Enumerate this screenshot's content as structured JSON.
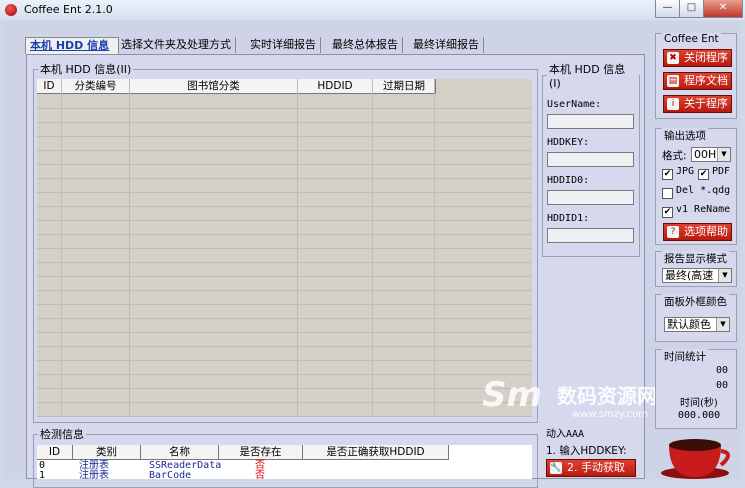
{
  "window": {
    "title": "Coffee Ent 2.1.0",
    "min_glyph": "—",
    "max_glyph": "□",
    "close_glyph": "✕"
  },
  "tabs": [
    {
      "label": "本机 HDD 信息",
      "active": true
    },
    {
      "label": "选择文件夹及处理方式",
      "active": false
    },
    {
      "label": "实时详细报告",
      "active": false
    },
    {
      "label": "最终总体报告",
      "active": false
    },
    {
      "label": "最终详细报告",
      "active": false
    }
  ],
  "hdd_grid": {
    "legend": "本机 HDD 信息(II)",
    "columns": [
      "ID",
      "分类编号",
      "图书馆分类",
      "HDDID",
      "过期日期"
    ]
  },
  "hdd_info": {
    "legend": "本机 HDD 信息(I)",
    "username_label": "UserName:",
    "hddkey_label": "HDDKEY:",
    "hddid0_label": "HDDID0:",
    "hddid1_label": "HDDID1:"
  },
  "manual": {
    "partial_text": "动入AAA",
    "input_label": "1. 输入HDDKEY:",
    "button_label": "2. 手动获取",
    "watermark": "数码资源网",
    "watermark_url": "www.smzy.com"
  },
  "detect": {
    "legend": "检测信息",
    "columns": [
      "ID",
      "类别",
      "名称",
      "是否存在",
      "是否正确获取HDDID"
    ],
    "rows": [
      {
        "id": "0",
        "category": "注册表",
        "name": "SSReaderData",
        "exists": "否"
      },
      {
        "id": "1",
        "category": "注册表",
        "name": "BarCode",
        "exists": "否"
      }
    ]
  },
  "right_panel": {
    "app_group": "Coffee Ent",
    "close_btn": "关闭程序",
    "doc_btn": "程序文档",
    "about_btn": "关于程序",
    "output_group": "输出选项",
    "format_label": "格式:",
    "format_value": "00H",
    "chk_jpg": "JPG",
    "chk_pdf": "PDF",
    "chk_del": "Del *.qdg",
    "chk_rename": "v1 ReName",
    "help_btn": "选项帮助",
    "report_group": "报告显示模式",
    "report_value": "最终(高速",
    "frame_group": "面板外框颜色",
    "frame_value": "默认颜色",
    "time_group": "时间统计",
    "time_00a": "00",
    "time_00b": "00",
    "time_sec": "时间(秒)",
    "time_total": "000.000"
  },
  "colors": {
    "accent_red": "#c8281c",
    "tab_active": "#1a3fb0",
    "panel": "#d6d8ee"
  }
}
